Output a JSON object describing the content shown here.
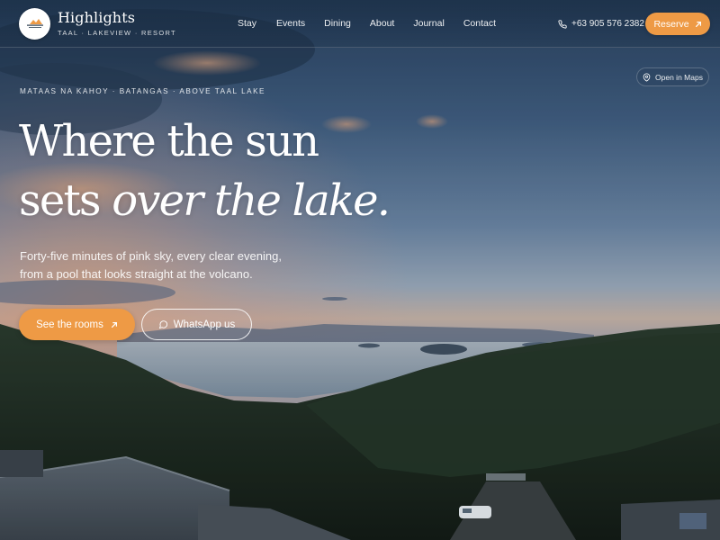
{
  "brand": {
    "name": "Highlights",
    "tagline": "TAAL · LAKEVIEW · RESORT",
    "logo_text": "HIGHLIGHTS"
  },
  "nav": {
    "items": [
      {
        "label": "Stay"
      },
      {
        "label": "Events"
      },
      {
        "label": "Dining"
      },
      {
        "label": "About"
      },
      {
        "label": "Journal"
      },
      {
        "label": "Contact"
      }
    ]
  },
  "header": {
    "phone": "+63 905 576 2382",
    "phone_icon": "phone-icon",
    "reserve_label": "Reserve",
    "reserve_icon": "arrow-up-right-icon"
  },
  "map": {
    "label": "Open in Maps",
    "icon": "map-pin-icon"
  },
  "hero": {
    "eyebrow": "MATAAS NA KAHOY · BATANGAS · ABOVE TAAL LAKE",
    "headline_line1": "Where the sun",
    "headline_line2_plain": "sets",
    "headline_line2_italic": "over the lake.",
    "subtext_line1": "Forty-five minutes of pink sky, every clear evening,",
    "subtext_line2": "from a pool that looks straight at the volcano.",
    "primary_cta": "See the rooms",
    "primary_cta_icon": "arrow-up-right-icon",
    "secondary_cta": "WhatsApp us",
    "secondary_cta_icon": "chat-bubble-icon"
  },
  "colors": {
    "accent": "#ee9a45",
    "sky_top": "#2c4866",
    "sky_mid": "#6d87a6",
    "horizon": "#c9b3a4",
    "lake": "#8d9fb0",
    "forest": "#1c2a1c"
  }
}
